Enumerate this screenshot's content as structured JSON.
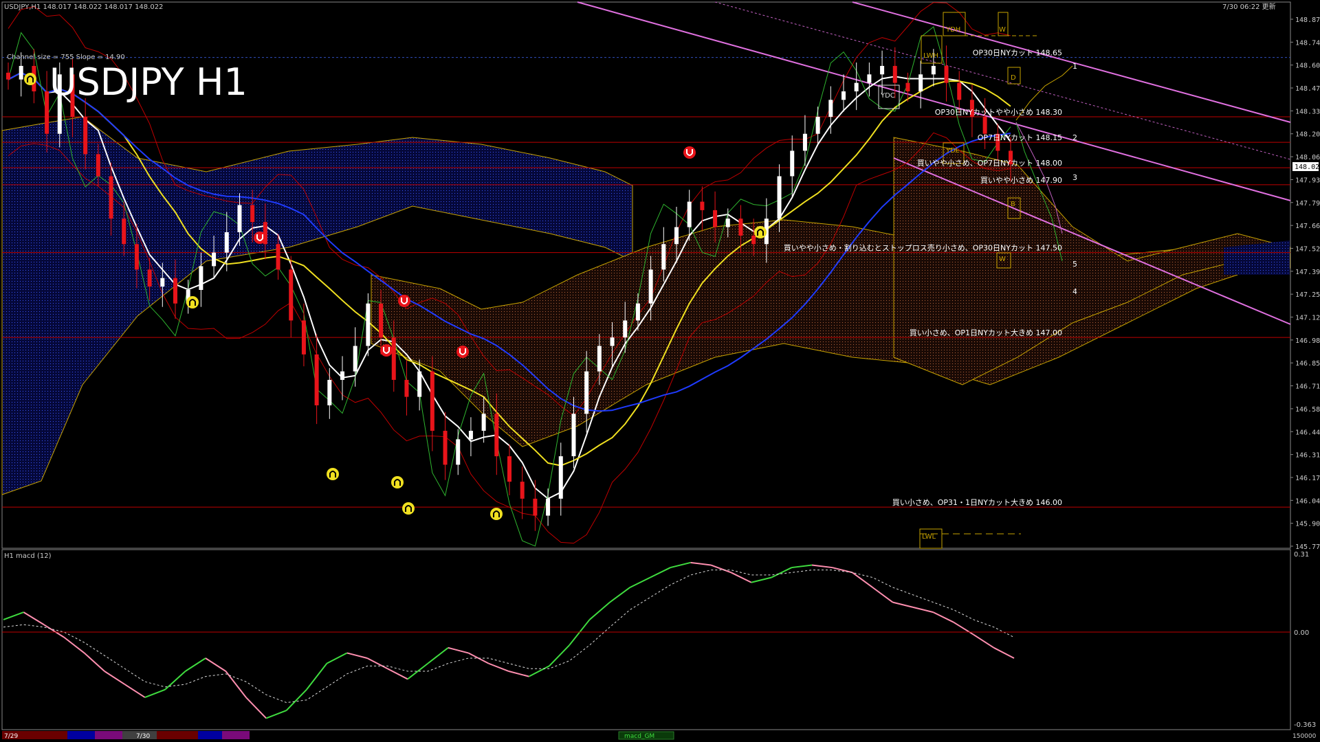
{
  "header": {
    "symbol_info": "USDJPY,H1  148.017 148.022 148.017 148.022",
    "updated": "7/30 06:22 更新",
    "title": "USDJPY H1",
    "channel_info": "Channel size = 755 Slope = 14.90"
  },
  "price_axis": {
    "labels": [
      "148.875",
      "148.740",
      "148.605",
      "148.470",
      "148.335",
      "148.200",
      "148.065",
      "147.930",
      "147.795",
      "147.660",
      "147.525",
      "147.390",
      "147.255",
      "147.120",
      "146.985",
      "146.850",
      "146.715",
      "146.580",
      "146.445",
      "146.310",
      "146.175",
      "146.040",
      "145.905",
      "145.770"
    ],
    "current": "148.022"
  },
  "macd_panel": {
    "label": "H1  macd (12)",
    "top": "0.31",
    "zero": "0.00",
    "bottom": "-0.363"
  },
  "bottom_bar": {
    "date1": "7/29",
    "date2": "7/30",
    "center_label": "macd_GM",
    "right_value": "150000"
  },
  "markers": {
    "ydh": "YDH",
    "w": "W",
    "lwh": "LWH",
    "ydc": "YDC",
    "ydl": "YDL",
    "lwl": "LWL",
    "d": "D",
    "b": "B",
    "bw": "W",
    "n1": "1",
    "n2": "2",
    "n3": "3",
    "n4": "4",
    "n5": "5"
  },
  "annotations": [
    {
      "text": "OP30日NYカット 148.65",
      "price": 148.65
    },
    {
      "text": "OP30日NYカットやや小さめ 148.30",
      "price": 148.3
    },
    {
      "text": "OP7日NYカット 148.15",
      "price": 148.15
    },
    {
      "text": "買いやや小さめ、OP7日NYカット 148.00",
      "price": 148.0
    },
    {
      "text": "買いやや小さめ 147.90",
      "price": 147.9
    },
    {
      "text": "買いやや小さめ・割り込むとストップロス売り小さめ、OP30日NYカット 147.50",
      "price": 147.5
    },
    {
      "text": "買い小さめ、OP1日NYカット大きめ 147.00",
      "price": 147.0
    },
    {
      "text": "買い小さめ、OP31・1日NYカット大きめ 146.00",
      "price": 146.0
    }
  ],
  "chart_data": {
    "type": "candlestick",
    "title": "USDJPY H1",
    "ylim": [
      145.77,
      148.875
    ],
    "horizontal_levels": [
      148.65,
      148.3,
      148.15,
      148.0,
      147.9,
      147.5,
      147.0,
      146.0
    ],
    "closes": [
      148.52,
      148.6,
      148.45,
      148.2,
      148.55,
      148.3,
      148.08,
      147.95,
      147.7,
      147.55,
      147.4,
      147.3,
      147.35,
      147.2,
      147.28,
      147.42,
      147.5,
      147.62,
      147.78,
      147.68,
      147.55,
      147.4,
      147.1,
      146.9,
      146.6,
      146.75,
      146.8,
      146.95,
      147.2,
      147.0,
      146.75,
      146.65,
      146.8,
      146.45,
      146.25,
      146.4,
      146.45,
      146.55,
      146.3,
      146.15,
      146.05,
      145.95,
      146.05,
      146.3,
      146.55,
      146.8,
      146.95,
      147.0,
      147.1,
      147.2,
      147.4,
      147.55,
      147.65,
      147.8,
      147.75,
      147.65,
      147.7,
      147.6,
      147.55,
      147.7,
      147.95,
      148.1,
      148.2,
      148.3,
      148.4,
      148.45,
      148.5,
      148.55,
      148.6,
      148.5,
      148.45,
      148.55,
      148.6,
      148.5,
      148.4,
      148.3,
      148.2,
      148.1,
      148.02
    ],
    "macd": [
      0.05,
      0.08,
      0.03,
      -0.02,
      -0.08,
      -0.15,
      -0.2,
      -0.25,
      -0.22,
      -0.15,
      -0.1,
      -0.15,
      -0.25,
      -0.33,
      -0.3,
      -0.22,
      -0.12,
      -0.08,
      -0.1,
      -0.14,
      -0.18,
      -0.12,
      -0.06,
      -0.08,
      -0.12,
      -0.15,
      -0.17,
      -0.13,
      -0.05,
      0.05,
      0.12,
      0.18,
      0.22,
      0.26,
      0.28,
      0.27,
      0.24,
      0.2,
      0.22,
      0.26,
      0.27,
      0.26,
      0.24,
      0.18,
      0.12,
      0.1,
      0.08,
      0.04,
      -0.01,
      -0.06,
      -0.1
    ],
    "macd_signal": [
      0.02,
      0.03,
      0.02,
      0.0,
      -0.04,
      -0.09,
      -0.14,
      -0.19,
      -0.21,
      -0.2,
      -0.17,
      -0.16,
      -0.19,
      -0.24,
      -0.27,
      -0.26,
      -0.21,
      -0.16,
      -0.13,
      -0.13,
      -0.15,
      -0.15,
      -0.12,
      -0.1,
      -0.1,
      -0.12,
      -0.14,
      -0.14,
      -0.11,
      -0.05,
      0.02,
      0.09,
      0.14,
      0.19,
      0.23,
      0.25,
      0.25,
      0.23,
      0.23,
      0.24,
      0.25,
      0.25,
      0.24,
      0.22,
      0.18,
      0.15,
      0.12,
      0.09,
      0.05,
      0.02,
      -0.02
    ]
  },
  "colors": {
    "up": "#ffffff",
    "down": "#e8141a",
    "ma_white": "#ffffff",
    "ma_yellow": "#f0e020",
    "ma_blue": "#1f3bff",
    "ichimoku_green": "#2fb52f",
    "level": "#c00000",
    "kumo_blue": "#1a2f9a",
    "kumo_brown": "#8a4a2a",
    "channel": "#e070e0",
    "macd_up": "#3fdc3f",
    "macd_down": "#ff8fb0"
  }
}
